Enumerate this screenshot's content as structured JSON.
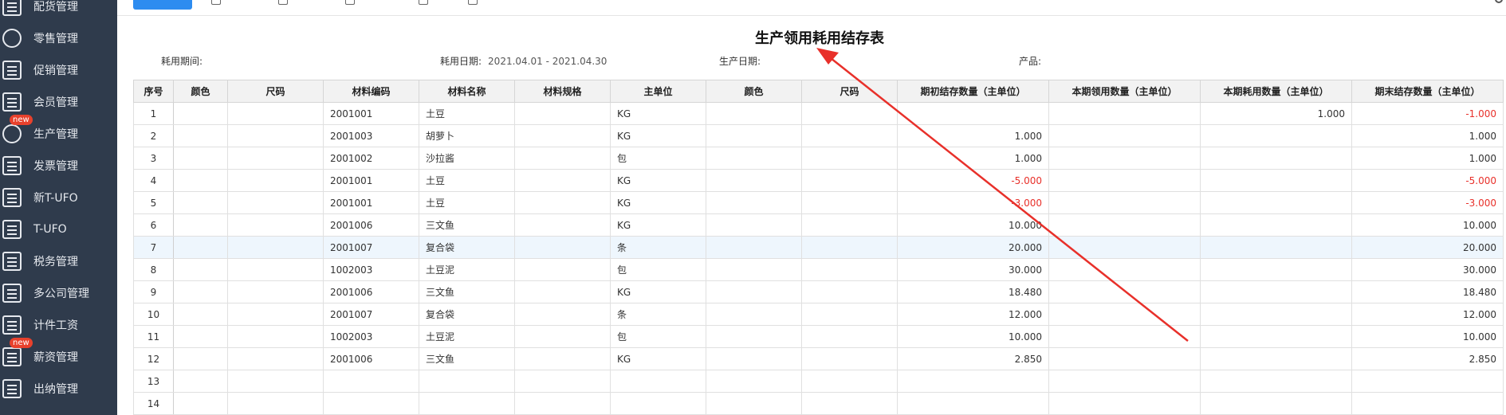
{
  "sidebar": {
    "items": [
      {
        "label": "配货管理",
        "icon": "truck-icon",
        "badge": ""
      },
      {
        "label": "零售管理",
        "icon": "shop-icon",
        "badge": ""
      },
      {
        "label": "促销管理",
        "icon": "megaphone-icon",
        "badge": ""
      },
      {
        "label": "会员管理",
        "icon": "member-card-icon",
        "badge": ""
      },
      {
        "label": "生产管理",
        "icon": "production-icon",
        "badge": "new"
      },
      {
        "label": "发票管理",
        "icon": "invoice-icon",
        "badge": ""
      },
      {
        "label": "新T-UFO",
        "icon": "report-icon",
        "badge": ""
      },
      {
        "label": "T-UFO",
        "icon": "ufo-icon",
        "badge": ""
      },
      {
        "label": "税务管理",
        "icon": "tax-icon",
        "badge": ""
      },
      {
        "label": "多公司管理",
        "icon": "building-icon",
        "badge": ""
      },
      {
        "label": "计件工资",
        "icon": "piecework-icon",
        "badge": ""
      },
      {
        "label": "薪资管理",
        "icon": "salary-icon",
        "badge": "new"
      },
      {
        "label": "出纳管理",
        "icon": "cashier-icon",
        "badge": ""
      }
    ]
  },
  "report": {
    "title": "生产领用耗用结存表",
    "meta": {
      "period_label": "耗用期间:",
      "period_value": "",
      "date_label": "耗用日期:",
      "date_value": "2021.04.01 - 2021.04.30",
      "prod_date_label": "生产日期:",
      "prod_date_value": "",
      "product_label": "产品:",
      "product_value": ""
    }
  },
  "table": {
    "headers": [
      "序号",
      "颜色",
      "尺码",
      "材料编码",
      "材料名称",
      "材料规格",
      "主单位",
      "颜色",
      "尺码",
      "期初结存数量（主单位）",
      "本期领用数量（主单位）",
      "本期耗用数量（主单位）",
      "期末结存数量（主单位）"
    ],
    "rows": [
      {
        "seq": "1",
        "color": "",
        "size": "",
        "code": "2001001",
        "name": "土豆",
        "spec": "",
        "unit": "KG",
        "color2": "",
        "size2": "",
        "opening": "",
        "received": "",
        "consumed": "1.000",
        "closing": "-1.000"
      },
      {
        "seq": "2",
        "color": "",
        "size": "",
        "code": "2001003",
        "name": "胡萝卜",
        "spec": "",
        "unit": "KG",
        "color2": "",
        "size2": "",
        "opening": "1.000",
        "received": "",
        "consumed": "",
        "closing": "1.000"
      },
      {
        "seq": "3",
        "color": "",
        "size": "",
        "code": "2001002",
        "name": "沙拉酱",
        "spec": "",
        "unit": "包",
        "color2": "",
        "size2": "",
        "opening": "1.000",
        "received": "",
        "consumed": "",
        "closing": "1.000"
      },
      {
        "seq": "4",
        "color": "",
        "size": "",
        "code": "2001001",
        "name": "土豆",
        "spec": "",
        "unit": "KG",
        "color2": "",
        "size2": "",
        "opening": "-5.000",
        "received": "",
        "consumed": "",
        "closing": "-5.000"
      },
      {
        "seq": "5",
        "color": "",
        "size": "",
        "code": "2001001",
        "name": "土豆",
        "spec": "",
        "unit": "KG",
        "color2": "",
        "size2": "",
        "opening": "-3.000",
        "received": "",
        "consumed": "",
        "closing": "-3.000"
      },
      {
        "seq": "6",
        "color": "",
        "size": "",
        "code": "2001006",
        "name": "三文鱼",
        "spec": "",
        "unit": "KG",
        "color2": "",
        "size2": "",
        "opening": "10.000",
        "received": "",
        "consumed": "",
        "closing": "10.000"
      },
      {
        "seq": "7",
        "color": "",
        "size": "",
        "code": "2001007",
        "name": "复合袋",
        "spec": "",
        "unit": "条",
        "color2": "",
        "size2": "",
        "opening": "20.000",
        "received": "",
        "consumed": "",
        "closing": "20.000"
      },
      {
        "seq": "8",
        "color": "",
        "size": "",
        "code": "1002003",
        "name": "土豆泥",
        "spec": "",
        "unit": "包",
        "color2": "",
        "size2": "",
        "opening": "30.000",
        "received": "",
        "consumed": "",
        "closing": "30.000"
      },
      {
        "seq": "9",
        "color": "",
        "size": "",
        "code": "2001006",
        "name": "三文鱼",
        "spec": "",
        "unit": "KG",
        "color2": "",
        "size2": "",
        "opening": "18.480",
        "received": "",
        "consumed": "",
        "closing": "18.480"
      },
      {
        "seq": "10",
        "color": "",
        "size": "",
        "code": "2001007",
        "name": "复合袋",
        "spec": "",
        "unit": "条",
        "color2": "",
        "size2": "",
        "opening": "12.000",
        "received": "",
        "consumed": "",
        "closing": "12.000"
      },
      {
        "seq": "11",
        "color": "",
        "size": "",
        "code": "1002003",
        "name": "土豆泥",
        "spec": "",
        "unit": "包",
        "color2": "",
        "size2": "",
        "opening": "10.000",
        "received": "",
        "consumed": "",
        "closing": "10.000"
      },
      {
        "seq": "12",
        "color": "",
        "size": "",
        "code": "2001006",
        "name": "三文鱼",
        "spec": "",
        "unit": "KG",
        "color2": "",
        "size2": "",
        "opening": "2.850",
        "received": "",
        "consumed": "",
        "closing": "2.850"
      },
      {
        "seq": "13",
        "color": "",
        "size": "",
        "code": "",
        "name": "",
        "spec": "",
        "unit": "",
        "color2": "",
        "size2": "",
        "opening": "",
        "received": "",
        "consumed": "",
        "closing": ""
      },
      {
        "seq": "14",
        "color": "",
        "size": "",
        "code": "",
        "name": "",
        "spec": "",
        "unit": "",
        "color2": "",
        "size2": "",
        "opening": "",
        "received": "",
        "consumed": "",
        "closing": ""
      }
    ],
    "highlighted_row": "7"
  },
  "colors": {
    "sidebar_bg": "#2f3b4c",
    "negative": "#e8302a",
    "annotation_arrow": "#e8302a",
    "primary": "#2d8cf0"
  }
}
